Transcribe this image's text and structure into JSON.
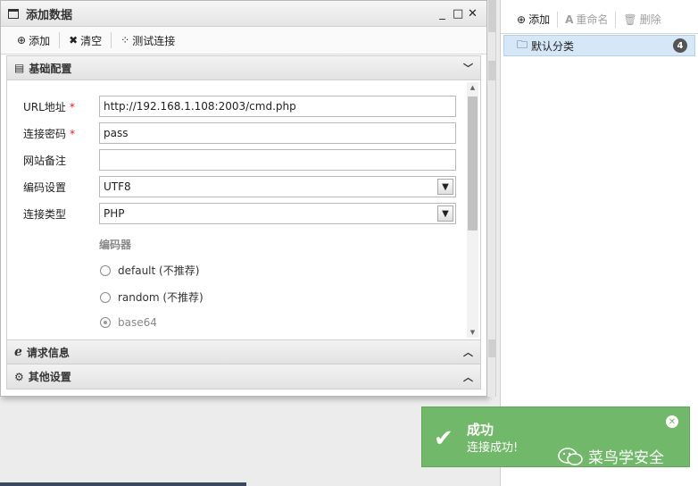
{
  "dialog": {
    "title": "添加数据",
    "controls": {
      "minimize": "_",
      "maximize": "□",
      "close": "✕"
    },
    "toolbar": {
      "add": "添加",
      "clear": "清空",
      "test": "测试连接"
    },
    "base_section": "基础配置",
    "fields": {
      "url_label": "URL地址",
      "url_value": "http://192.168.1.108:2003/cmd.php",
      "password_label": "连接密码",
      "password_value": "pass",
      "note_label": "网站备注",
      "note_value": "",
      "encoding_label": "编码设置",
      "encoding_value": "UTF8",
      "type_label": "连接类型",
      "type_value": "PHP",
      "required_mark": "*"
    },
    "encoder": {
      "title": "编码器",
      "options": [
        "default (不推荐)",
        "random (不推荐)",
        "base64"
      ],
      "selected": "base64"
    },
    "request_section": "请求信息",
    "other_section": "其他设置"
  },
  "right_panel": {
    "toolbar": {
      "add": "添加",
      "rename": "重命名",
      "delete": "删除"
    },
    "category": {
      "label": "默认分类",
      "count": "4"
    }
  },
  "toast": {
    "title": "成功",
    "message": "连接成功!",
    "watermark": "菜鸟学安全"
  },
  "colors": {
    "toast_bg": "#72b86a",
    "selection_bg": "#d6e7f8",
    "required": "#e02020"
  }
}
